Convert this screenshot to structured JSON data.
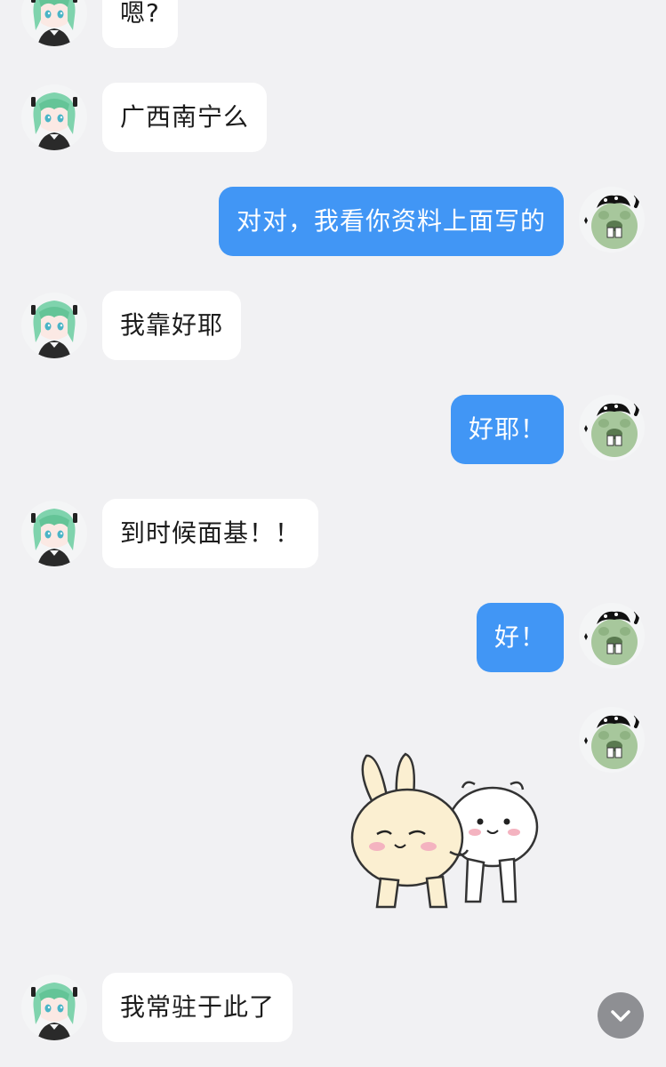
{
  "messages": [
    {
      "sender": "other",
      "text": "嗯?"
    },
    {
      "sender": "other",
      "text": "广西南宁么"
    },
    {
      "sender": "self",
      "text": "对对，我看你资料上面写的"
    },
    {
      "sender": "other",
      "text": "我靠好耶"
    },
    {
      "sender": "self",
      "text": "好耶！"
    },
    {
      "sender": "other",
      "text": "到时候面基！！"
    },
    {
      "sender": "self",
      "text": "好！"
    },
    {
      "sender": "self",
      "sticker": "rabbit-and-hamster-hug-sticker"
    },
    {
      "sender": "other",
      "text": "我常驻于此了"
    }
  ],
  "avatars": {
    "other": "green-hair-anime-girl-avatar",
    "self": "green-beaver-with-black-hat-avatar"
  },
  "controls": {
    "scroll_to_bottom_icon": "chevron-down-icon"
  },
  "colors": {
    "background": "#f1f1f3",
    "incoming_bubble": "#ffffff",
    "outgoing_bubble": "#4196f5",
    "scroll_button": "#8e8f93"
  }
}
